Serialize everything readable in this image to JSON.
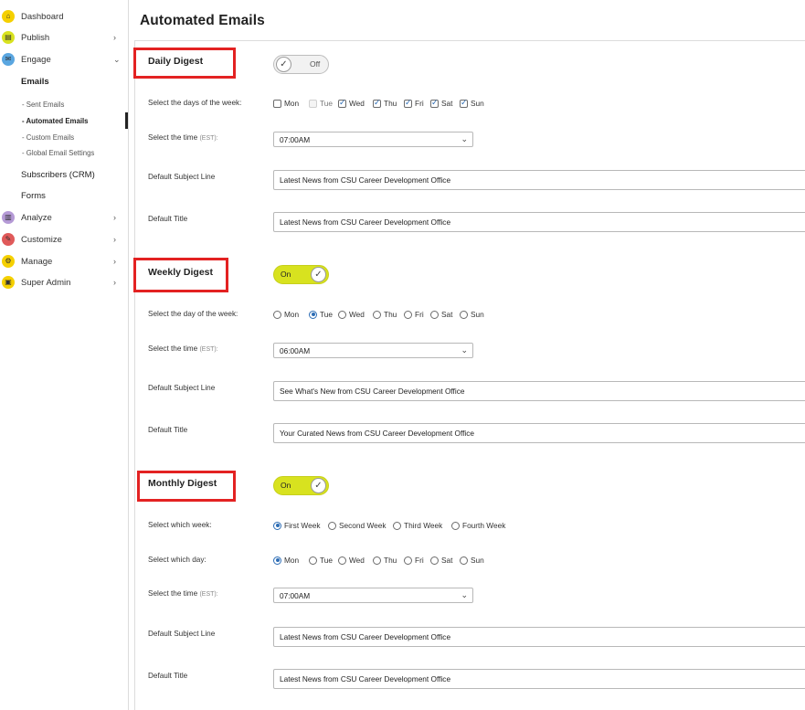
{
  "sidebar": {
    "items": [
      {
        "label": "Dashboard",
        "icon": "home-icon",
        "color": "#f5d000",
        "chevron": ""
      },
      {
        "label": "Publish",
        "icon": "publish-icon",
        "color": "#d8e21f",
        "chevron": "›"
      },
      {
        "label": "Engage",
        "icon": "engage-icon",
        "color": "#5aa6e0",
        "chevron": "⌄"
      },
      {
        "label": "Analyze",
        "icon": "analyze-icon",
        "color": "#b59ad6",
        "chevron": "›"
      },
      {
        "label": "Customize",
        "icon": "customize-icon",
        "color": "#e05a5a",
        "chevron": "›"
      },
      {
        "label": "Manage",
        "icon": "manage-icon",
        "color": "#f5d000",
        "chevron": "›"
      },
      {
        "label": "Super Admin",
        "icon": "admin-icon",
        "color": "#f5d000",
        "chevron": "›"
      }
    ],
    "engage_sub": {
      "emails": "Emails",
      "sent": "- Sent Emails",
      "automated": "- Automated Emails",
      "custom": "- Custom Emails",
      "global": "- Global Email Settings",
      "subscribers": "Subscribers (CRM)",
      "forms": "Forms"
    }
  },
  "page": {
    "title": "Automated Emails"
  },
  "daily": {
    "title": "Daily Digest",
    "toggle": "Off",
    "days_label": "Select the days of the week:",
    "days": [
      {
        "label": "Mon",
        "checked": false,
        "disabled": false
      },
      {
        "label": "Tue",
        "checked": false,
        "disabled": true
      },
      {
        "label": "Wed",
        "checked": true,
        "disabled": false
      },
      {
        "label": "Thu",
        "checked": true,
        "disabled": false
      },
      {
        "label": "Fri",
        "checked": true,
        "disabled": false
      },
      {
        "label": "Sat",
        "checked": true,
        "disabled": false
      },
      {
        "label": "Sun",
        "checked": true,
        "disabled": false
      }
    ],
    "time_label": "Select the time",
    "time_zone": "(EST):",
    "time": "07:00AM",
    "subject_label": "Default Subject Line",
    "subject": "Latest News from CSU Career Development Office",
    "title_label": "Default Title",
    "title_value": "Latest News from CSU Career Development Office"
  },
  "weekly": {
    "title": "Weekly Digest",
    "toggle": "On",
    "day_label": "Select the day of the week:",
    "days": [
      "Mon",
      "Tue",
      "Wed",
      "Thu",
      "Fri",
      "Sat",
      "Sun"
    ],
    "selected_day": "Tue",
    "time_label": "Select the time",
    "time_zone": "(EST):",
    "time": "06:00AM",
    "subject_label": "Default Subject Line",
    "subject": "See What's New from CSU Career Development Office",
    "title_label": "Default Title",
    "title_value": "Your Curated News from CSU Career Development Office"
  },
  "monthly": {
    "title": "Monthly Digest",
    "toggle": "On",
    "week_label": "Select which week:",
    "weeks": [
      "First Week",
      "Second Week",
      "Third Week",
      "Fourth Week"
    ],
    "selected_week": "First Week",
    "day_label": "Select which day:",
    "days": [
      "Mon",
      "Tue",
      "Wed",
      "Thu",
      "Fri",
      "Sat",
      "Sun"
    ],
    "selected_day": "Mon",
    "time_label": "Select the time",
    "time_zone": "(EST):",
    "time": "07:00AM",
    "subject_label": "Default Subject Line",
    "subject": "Latest News from CSU Career Development Office",
    "title_label": "Default Title",
    "title_value": "Latest News from CSU Career Development Office"
  },
  "colors": {
    "highlight": "#e32222",
    "toggle_on": "#d8e21f",
    "accent": "#2d6db5"
  }
}
